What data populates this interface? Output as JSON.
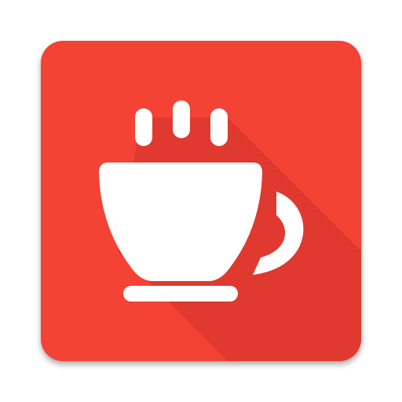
{
  "icon": {
    "name": "coffee-cup-icon",
    "colors": {
      "tile": "#f44336",
      "tile_shadow": "#d8392f",
      "long_shadow": "#e0392f",
      "glyph": "#ffffff"
    }
  }
}
